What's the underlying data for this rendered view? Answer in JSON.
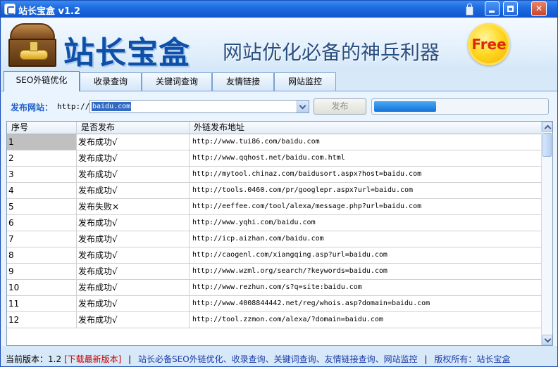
{
  "window": {
    "title": "站长宝盒 v1.2"
  },
  "banner": {
    "brand": "站长宝盒",
    "slogan": "网站优化必备的神兵利器",
    "badge": "Free"
  },
  "tabs": [
    {
      "label": "SEO外链优化",
      "active": true
    },
    {
      "label": "收录查询"
    },
    {
      "label": "关键词查询"
    },
    {
      "label": "友情链接"
    },
    {
      "label": "网站监控"
    }
  ],
  "publish": {
    "label": "发布网站：",
    "prefix": "http://",
    "value": "baidu.com",
    "button": "发布",
    "progress": 0.36
  },
  "table": {
    "headers": [
      "序号",
      "是否发布",
      "外链发布地址"
    ],
    "rows": [
      {
        "no": "1",
        "status": "发布成功√",
        "url": "http://www.tui86.com/baidu.com"
      },
      {
        "no": "2",
        "status": "发布成功√",
        "url": "http://www.qqhost.net/baidu.com.html"
      },
      {
        "no": "3",
        "status": "发布成功√",
        "url": "http://mytool.chinaz.com/baidusort.aspx?host=baidu.com"
      },
      {
        "no": "4",
        "status": "发布成功√",
        "url": "http://tools.0460.com/pr/googlepr.aspx?url=baidu.com"
      },
      {
        "no": "5",
        "status": "发布失败×",
        "url": "http://eeffee.com/tool/alexa/message.php?url=baidu.com"
      },
      {
        "no": "6",
        "status": "发布成功√",
        "url": "http://www.yqhi.com/baidu.com"
      },
      {
        "no": "7",
        "status": "发布成功√",
        "url": "http://icp.aizhan.com/baidu.com"
      },
      {
        "no": "8",
        "status": "发布成功√",
        "url": "http://caogenl.com/xiangqing.asp?url=baidu.com"
      },
      {
        "no": "9",
        "status": "发布成功√",
        "url": "http://www.wzml.org/search/?keywords=baidu.com"
      },
      {
        "no": "10",
        "status": "发布成功√",
        "url": "http://www.rezhun.com/s?q=site:baidu.com"
      },
      {
        "no": "11",
        "status": "发布成功√",
        "url": "http://www.4008844442.net/reg/whois.asp?domain=baidu.com"
      },
      {
        "no": "12",
        "status": "发布成功√",
        "url": "http://tool.zzmon.com/alexa/?domain=baidu.com"
      }
    ]
  },
  "status": {
    "version_label": "当前版本：",
    "version": "1.2",
    "download": "[下载最新版本]",
    "description": "站长必备SEO外链优化、收录查询、关键词查询、友情链接查询、网站监控",
    "copyright": "版权所有：站长宝盒"
  }
}
